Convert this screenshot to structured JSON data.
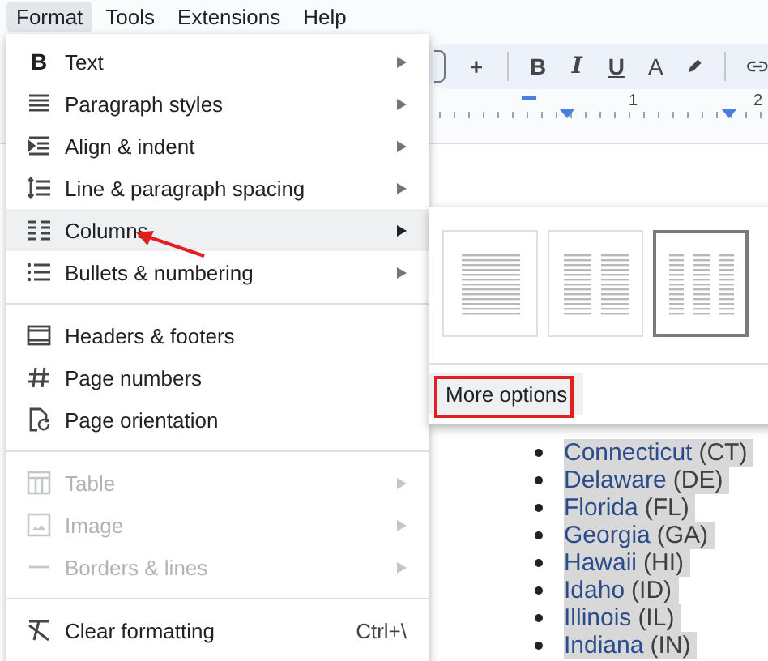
{
  "menubar": [
    {
      "label": "Format",
      "selected": true
    },
    {
      "label": "Tools",
      "selected": false
    },
    {
      "label": "Extensions",
      "selected": false
    },
    {
      "label": "Help",
      "selected": false
    }
  ],
  "toolbar": {
    "buttons": [
      "+",
      "B",
      "I",
      "U",
      "A"
    ]
  },
  "ruler": {
    "marks": [
      "1",
      "2"
    ]
  },
  "format_menu": [
    {
      "kind": "item",
      "icon_text": "B",
      "label": "Text",
      "submenu": true,
      "disabled": false,
      "selected": false
    },
    {
      "kind": "item",
      "label": "Paragraph styles",
      "submenu": true,
      "disabled": false,
      "selected": false
    },
    {
      "kind": "item",
      "label": "Align & indent",
      "submenu": true,
      "disabled": false,
      "selected": false
    },
    {
      "kind": "item",
      "label": "Line & paragraph spacing",
      "submenu": true,
      "disabled": false,
      "selected": false
    },
    {
      "kind": "item",
      "label": "Columns",
      "submenu": true,
      "disabled": false,
      "selected": true
    },
    {
      "kind": "item",
      "label": "Bullets & numbering",
      "submenu": true,
      "disabled": false,
      "selected": false
    },
    {
      "kind": "separator"
    },
    {
      "kind": "item",
      "label": "Headers & footers",
      "submenu": false,
      "disabled": false,
      "selected": false
    },
    {
      "kind": "item",
      "label": "Page numbers",
      "submenu": false,
      "disabled": false,
      "selected": false
    },
    {
      "kind": "item",
      "label": "Page orientation",
      "submenu": false,
      "disabled": false,
      "selected": false
    },
    {
      "kind": "separator"
    },
    {
      "kind": "item",
      "label": "Table",
      "submenu": true,
      "disabled": true,
      "selected": false
    },
    {
      "kind": "item",
      "label": "Image",
      "submenu": true,
      "disabled": true,
      "selected": false
    },
    {
      "kind": "item",
      "label": "Borders & lines",
      "submenu": true,
      "disabled": true,
      "selected": false
    },
    {
      "kind": "separator"
    },
    {
      "kind": "item",
      "label": "Clear formatting",
      "submenu": false,
      "disabled": false,
      "selected": false,
      "shortcut": "Ctrl+\\"
    }
  ],
  "columns_submenu": {
    "options": [
      {
        "selected": false
      },
      {
        "selected": false
      },
      {
        "selected": true
      }
    ],
    "more_options": {
      "label": "More options",
      "selected": true
    }
  },
  "states": [
    {
      "name": "Connecticut",
      "abbr": "(CT)"
    },
    {
      "name": "Delaware",
      "abbr": "(DE)"
    },
    {
      "name": "Florida",
      "abbr": "(FL)"
    },
    {
      "name": "Georgia",
      "abbr": "(GA)"
    },
    {
      "name": "Hawaii",
      "abbr": "(HI)"
    },
    {
      "name": "Idaho",
      "abbr": "(ID)"
    },
    {
      "name": "Illinois",
      "abbr": "(IL)"
    },
    {
      "name": "Indiana",
      "abbr": "(IN)"
    }
  ]
}
